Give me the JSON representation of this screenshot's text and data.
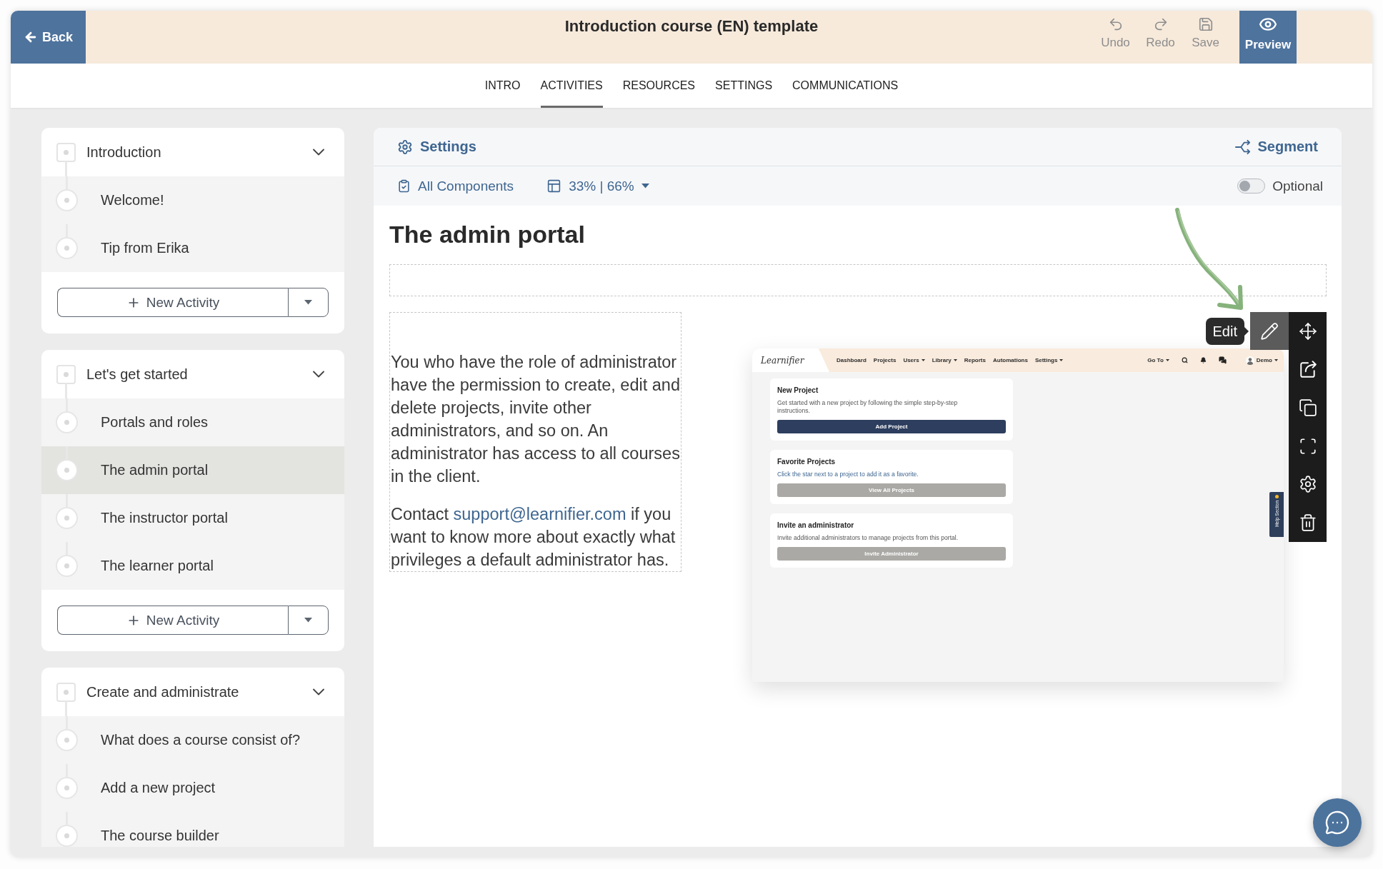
{
  "header": {
    "back": "Back",
    "title": "Introduction course (EN) template",
    "actions": [
      {
        "kind": "undo",
        "label": "Undo",
        "disabled": true
      },
      {
        "kind": "redo",
        "label": "Redo",
        "disabled": true
      },
      {
        "kind": "save",
        "label": "Save",
        "disabled": true
      }
    ],
    "preview": "Preview"
  },
  "tabs": [
    {
      "label": "INTRO",
      "selected": false
    },
    {
      "label": "ACTIVITIES",
      "selected": true
    },
    {
      "label": "RESOURCES",
      "selected": false
    },
    {
      "label": "SETTINGS",
      "selected": false
    },
    {
      "label": "COMMUNICATIONS",
      "selected": false
    }
  ],
  "sidebar": {
    "sections": [
      {
        "title": "Introduction",
        "expanded": true,
        "children": [
          {
            "label": "Welcome!",
            "selected": false
          },
          {
            "label": "Tip from Erika",
            "selected": false
          }
        ],
        "add_button": "New Activity"
      },
      {
        "title": "Let's get started",
        "expanded": true,
        "children": [
          {
            "label": "Portals and roles",
            "selected": false
          },
          {
            "label": "The admin portal",
            "selected": true
          },
          {
            "label": "The instructor portal",
            "selected": false
          },
          {
            "label": "The learner portal",
            "selected": false
          }
        ],
        "add_button": "New Activity"
      },
      {
        "title": "Create and administrate",
        "expanded": true,
        "children": [
          {
            "label": "What does a course consist of?",
            "selected": false
          },
          {
            "label": "Add a new project",
            "selected": false
          },
          {
            "label": "The course builder",
            "selected": false
          }
        ]
      }
    ]
  },
  "editor": {
    "settings": "Settings",
    "segment": "Segment",
    "components": "All Components",
    "layout": "33% | 66%",
    "optional": {
      "label": "Optional",
      "on": false
    },
    "heading": "The admin portal",
    "paragraphs": [
      {
        "parts": [
          {
            "text": "You who have the role of administrator have the permission to create, edit and delete projects, invite other administrators, and so on. An administrator has access to all courses in the client.",
            "link": false
          }
        ]
      },
      {
        "parts": [
          {
            "text": "Contact ",
            "link": false
          },
          {
            "text": "support@learnifier.com",
            "link": true
          },
          {
            "text": " if you want to know more about exactly what privileges a default administrator has.",
            "link": false
          }
        ]
      }
    ],
    "toolbar": {
      "tooltip": "Edit",
      "edit_hovered": true
    }
  },
  "portal_preview": {
    "logo": "Learnifier",
    "nav": [
      {
        "label": "Dashboard",
        "dropdown": false
      },
      {
        "label": "Projects",
        "dropdown": false
      },
      {
        "label": "Users",
        "dropdown": true
      },
      {
        "label": "Library",
        "dropdown": true
      },
      {
        "label": "Reports",
        "dropdown": false
      },
      {
        "label": "Automations",
        "dropdown": false
      },
      {
        "label": "Settings",
        "dropdown": true
      }
    ],
    "goto": "Go To",
    "user": "Demo",
    "cards": [
      {
        "title": "New Project",
        "text": "Get started with a new project by following the simple step-by-step instructions.",
        "link": false,
        "button": {
          "label": "Add Project",
          "primary": true
        }
      },
      {
        "title": "Favorite Projects",
        "text": "Click the star next to a project to add it as a favorite.",
        "link": true,
        "button": {
          "label": "View All Projects",
          "primary": false
        }
      },
      {
        "title": "Invite an administrator",
        "text": "Invite additional administrators to manage projects from this portal.",
        "link": false,
        "button": {
          "label": "Invite Administrator",
          "primary": false
        }
      }
    ],
    "help_tab": "Help Section"
  }
}
